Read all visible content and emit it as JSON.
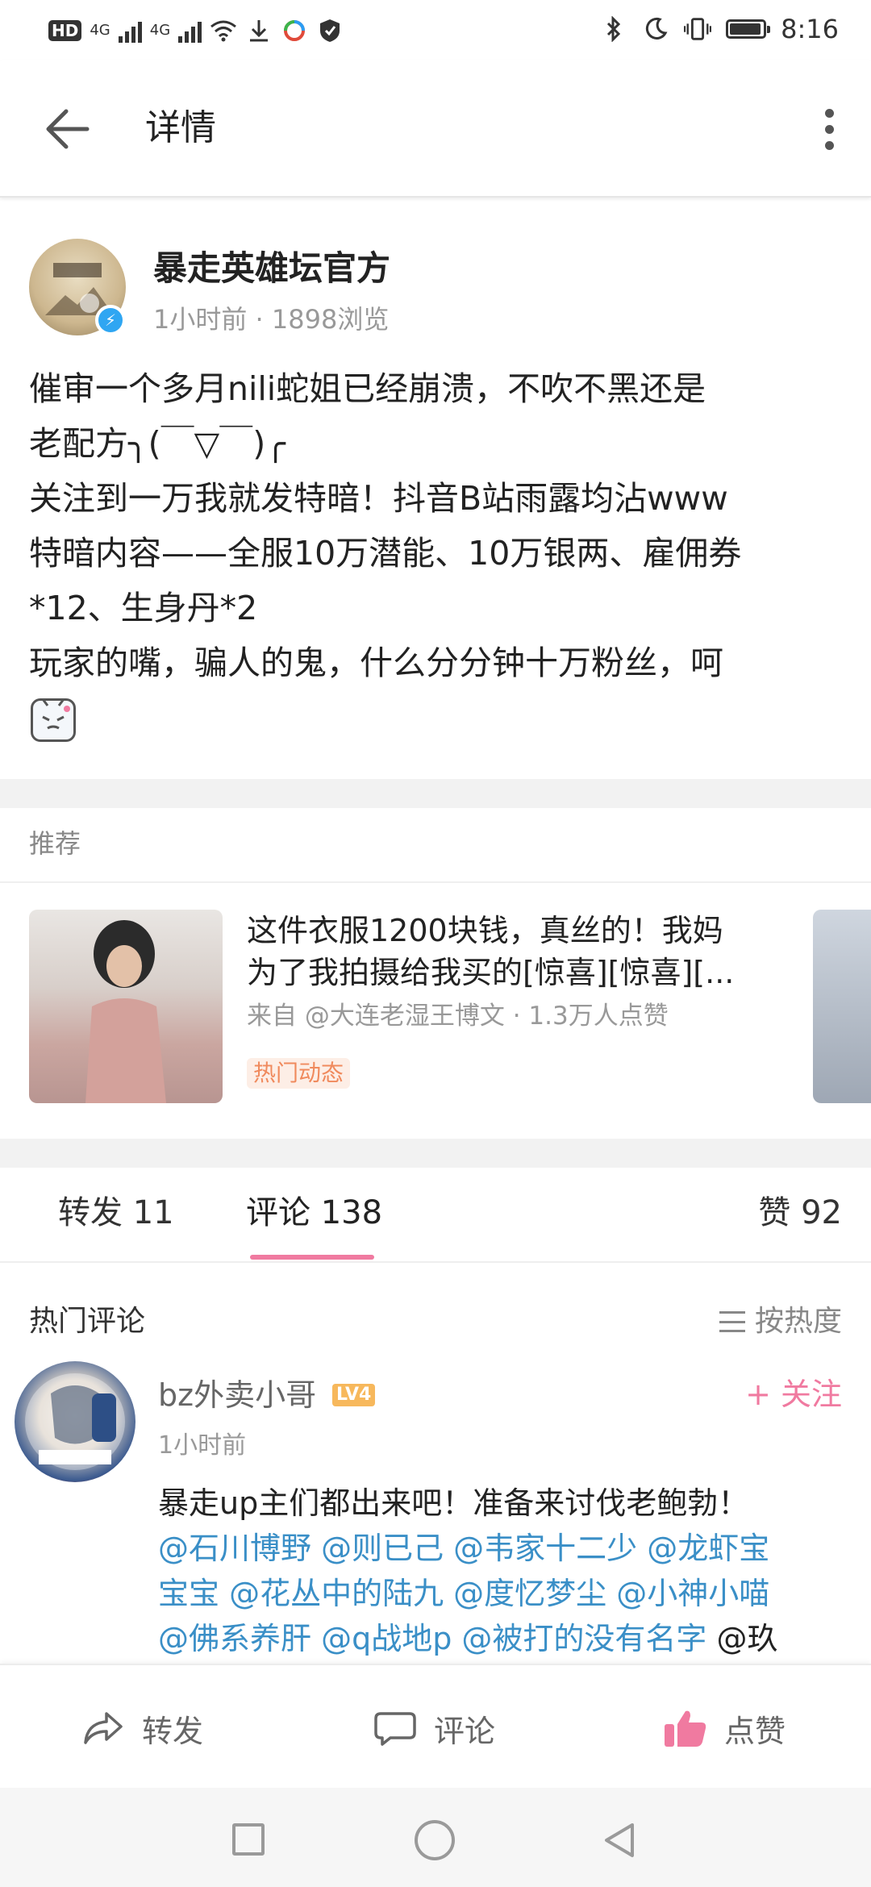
{
  "status_bar": {
    "hd": "HD",
    "net1": "4G",
    "net2": "4G",
    "time": "8:16"
  },
  "header": {
    "title": "详情",
    "back_icon": "arrow-left-icon",
    "more_icon": "more-vertical-icon"
  },
  "post": {
    "author": "暴走英雄坛官方",
    "meta": "1小时前 · 1898浏览",
    "lines": [
      "催审一个多月nili蛇姐已经崩溃，不吹不黑还是",
      "老配方╮(￣▽￣)╭",
      "关注到一万我就发特暗！抖音B站雨露均沾www",
      "特暗内容——全服10万潜能、10万银两、雇佣券",
      "*12、生身丹*2",
      "玩家的嘴，骗人的鬼，什么分分钟十万粉丝，呵"
    ]
  },
  "recommend": {
    "title": "推荐",
    "item": {
      "line1": "这件衣服1200块钱，真丝的！我妈",
      "line2": "为了我拍摄给我买的[惊喜][惊喜][...",
      "source": "来自 @大连老湿王博文 · 1.3万人点赞",
      "tag": "热门动态"
    }
  },
  "tabs": {
    "repost": "转发 11",
    "comment": "评论 138",
    "like": "赞 92"
  },
  "comments": {
    "title": "热门评论",
    "sort_label": "按热度",
    "item": {
      "name": "bz外卖小哥",
      "level": "LV4",
      "follow": "+ 关注",
      "time": "1小时前",
      "text_line1": "暴走up主们都出来吧！准备来讨伐老鲍勃！",
      "line2_mentions": "@石川博野 @则已己 @韦家十二少 @龙虾宝",
      "line3_mentions": "宝宝 @花丛中的陆九 @度忆梦尘 @小神小喵",
      "line4_mentions": "@佛系养肝 @q战地p @被打的没有名字",
      "line4_tail": " @玖"
    }
  },
  "action_bar": {
    "repost": "转发",
    "comment": "评论",
    "like": "点赞"
  },
  "colors": {
    "accent_pink": "#f07aa0",
    "mention_blue": "#3a8fc7",
    "verified_blue": "#2fa6f2",
    "tag_orange": "#f08a5d"
  }
}
